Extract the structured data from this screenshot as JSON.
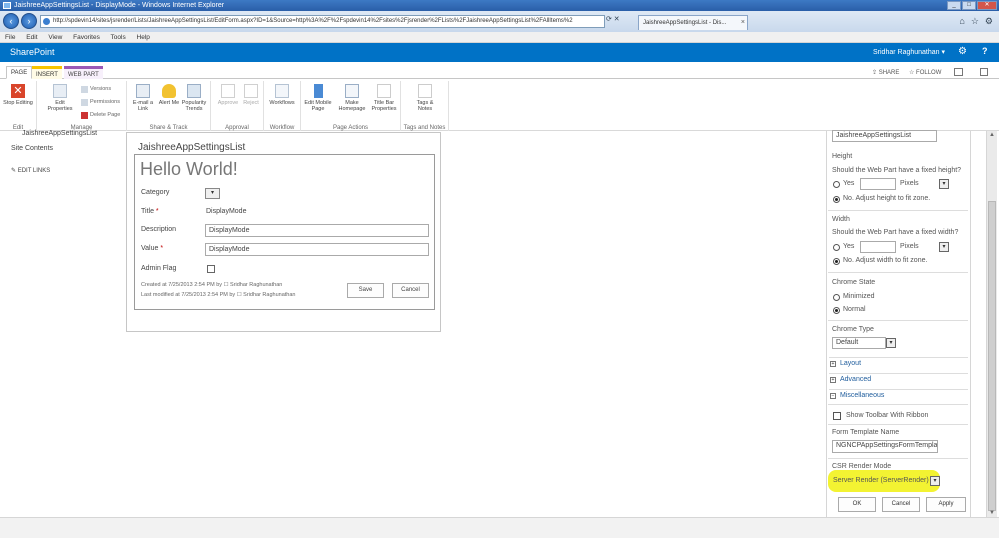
{
  "window": {
    "title": "JaishreeAppSettingsList - DisplayMode - Windows Internet Explorer"
  },
  "browser": {
    "url": "http://spdevin14/sites/jsrender/Lists/JaishreeAppSettingsList/EditForm.aspx?ID=1&Source=http%3A%2F%2Fspdevin14%2Fsites%2Fjsrender%2FLists%2FJaishreeAppSettingsList%2FAllItems%2",
    "tab_title": "JaishreeAppSettingsList - Dis...",
    "menu": [
      "File",
      "Edit",
      "View",
      "Favorites",
      "Tools",
      "Help"
    ]
  },
  "suite": {
    "brand": "SharePoint",
    "user": "Sridhar Raghunathan ▾"
  },
  "ribbon_tabs": {
    "page": "PAGE",
    "insert": "INSERT",
    "webpart": "WEB PART",
    "share": "SHARE",
    "follow": "FOLLOW"
  },
  "ribbon": {
    "stop_editing": "Stop Editing",
    "edit_properties": "Edit Properties",
    "versions": "Versions",
    "permissions": "Permissions",
    "delete_page": "Delete Page",
    "email_link": "E-mail a Link",
    "alert_me": "Alert Me",
    "popularity_trends": "Popularity Trends",
    "approve": "Approve",
    "reject": "Reject",
    "workflows": "Workflows",
    "edit_mobile_page": "Edit Mobile Page",
    "make_homepage": "Make Homepage",
    "title_bar_properties": "Title Bar Properties",
    "tags_notes": "Tags & Notes",
    "groups": {
      "edit": "Edit",
      "manage": "Manage",
      "share_track": "Share & Track",
      "approval": "Approval",
      "workflow": "Workflow",
      "page_actions": "Page Actions",
      "tags_notes": "Tags and Notes"
    }
  },
  "leftnav": {
    "list_link": "JaishreeAppSettingsList",
    "site_contents": "Site Contents",
    "edit_links": "EDIT LINKS"
  },
  "webpart": {
    "title": "JaishreeAppSettingsList",
    "heading": "Hello World!",
    "category_label": "Category",
    "title_label": "Title",
    "title_value": "DisplayMode",
    "description_label": "Description",
    "description_value": "DisplayMode",
    "value_label": "Value",
    "value_value": "DisplayMode",
    "admin_flag_label": "Admin Flag",
    "required_marker": "*",
    "created": "Created at 7/25/2013 2:54 PM  by",
    "created_by": "Sridhar Raghunathan",
    "modified": "Last modified at 7/25/2013 2:54 PM  by",
    "modified_by": "Sridhar Raghunathan",
    "save": "Save",
    "cancel": "Cancel"
  },
  "toolpane": {
    "title_value": "JaishreeAppSettingsList",
    "height_heading": "Height",
    "height_question": "Should the Web Part have a fixed height?",
    "yes": "Yes",
    "pixels": "Pixels",
    "height_no": "No. Adjust height to fit zone.",
    "width_heading": "Width",
    "width_question": "Should the Web Part have a fixed width?",
    "width_no": "No. Adjust width to fit zone.",
    "chrome_state": "Chrome State",
    "minimized": "Minimized",
    "normal": "Normal",
    "chrome_type": "Chrome Type",
    "chrome_type_value": "Default",
    "layout": "Layout",
    "advanced": "Advanced",
    "miscellaneous": "Miscellaneous",
    "show_toolbar": "Show Toolbar With Ribbon",
    "form_template_name": "Form Template Name",
    "form_template_value": "NGNCPAppSettingsFormTempla",
    "csr_render_mode": "CSR Render Mode",
    "csr_value": "Server Render (ServerRender)",
    "ok": "OK",
    "cancel": "Cancel",
    "apply": "Apply"
  },
  "colors": {
    "suite_blue": "#0072c6",
    "highlight": "#f3f332",
    "link_blue": "#1e5c9c"
  }
}
